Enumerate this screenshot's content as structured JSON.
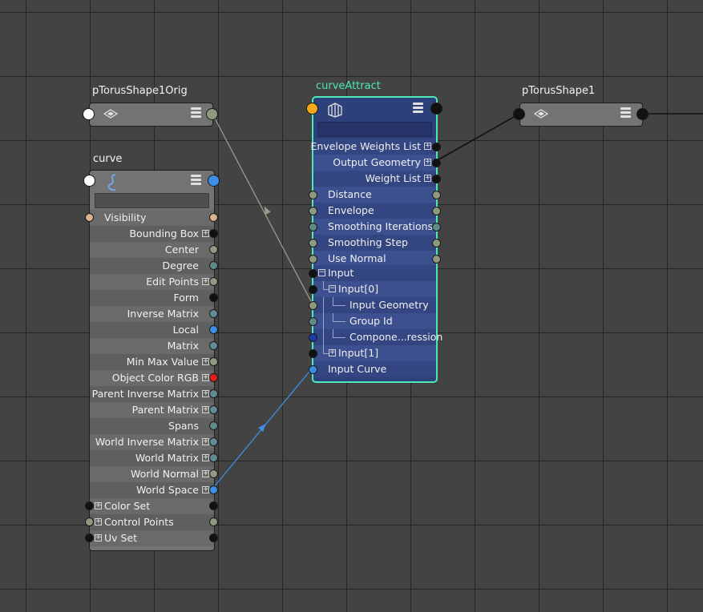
{
  "nodes": {
    "torus_orig": {
      "title": "pTorusShape1Orig"
    },
    "torus": {
      "title": "pTorusShape1"
    },
    "curve": {
      "title": "curve",
      "visibility": "Visibility",
      "attributes": [
        "Bounding Box",
        "Center",
        "Degree",
        "Edit Points",
        "Form",
        "Inverse Matrix",
        "Local",
        "Matrix",
        "Min Max Value",
        "Object Color RGB",
        "Parent Inverse Matrix",
        "Parent Matrix",
        "Spans",
        "World Inverse Matrix",
        "World Matrix",
        "World Normal",
        "World Space"
      ],
      "compound_inputs": [
        "Color Set",
        "Control Points",
        "Uv Set"
      ]
    },
    "curve_attract": {
      "title": "curveAttract",
      "outputs": [
        "Envelope Weights List",
        "Output Geometry",
        "Weight List"
      ],
      "attributes": [
        "Distance",
        "Envelope",
        "Smoothing Iterations",
        "Smoothing Step",
        "Use Normal"
      ],
      "input": "Input",
      "input0": "Input[0]",
      "input_geometry": "Input Geometry",
      "group_id": "Group Id",
      "components": "Compone...ression",
      "input1": "Input[1]",
      "input_curve": "Input Curve"
    }
  },
  "colors": {
    "selection": "#4de8b8",
    "node_grey": "#737373",
    "node_blue": "#2e4079",
    "wire_blue": "#3d8fe6",
    "wire_grey": "#9a9a8a"
  }
}
